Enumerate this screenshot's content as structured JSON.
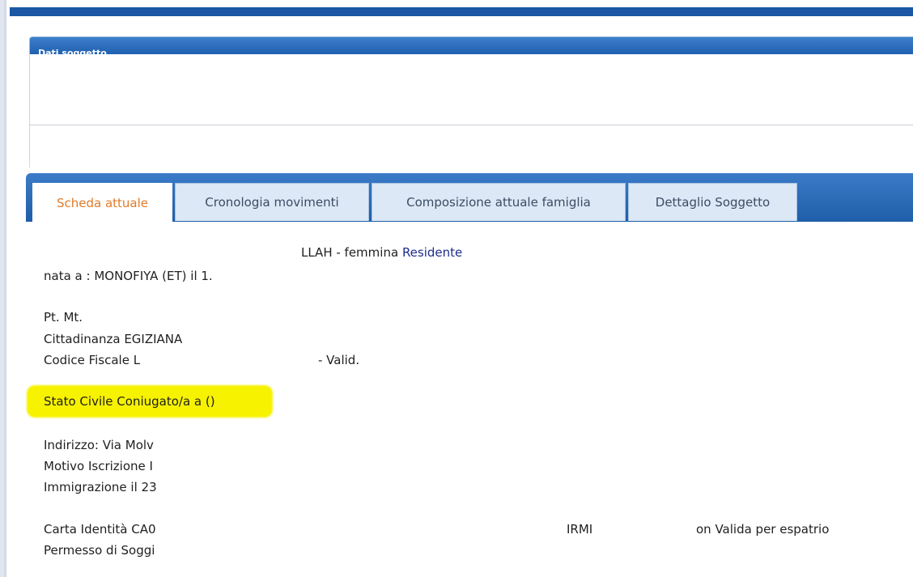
{
  "panel": {
    "title": "Dati soggetto"
  },
  "tabs": [
    {
      "label": "Scheda attuale",
      "active": true
    },
    {
      "label": "Cronologia movimenti",
      "active": false
    },
    {
      "label": "Composizione attuale famiglia",
      "active": false
    },
    {
      "label": "Dettaglio Soggetto",
      "active": false
    }
  ],
  "scheda": {
    "nome_suffix": "LLAH - femmina",
    "residenza": "Residente",
    "nascita": "nata a : MONOFIYA (ET) il 1.",
    "paternita": "Pt. Mt.",
    "cittadinanza": "Cittadinanza EGIZIANA",
    "codice_fiscale_label": "Codice Fiscale L",
    "codice_fiscale_status": "- Valid.",
    "stato_civile_label": "Stato Civile",
    "stato_civile_value": "Coniugato/a a ()",
    "indirizzo": "Indirizzo: Via Molv",
    "motivo_iscrizione": "Motivo Iscrizione I",
    "immigrazione": "Immigrazione il 23",
    "carta_identita": "Carta Identità CA0",
    "carta_fragment": "IRMI",
    "carta_status": "on Valida per espatrio",
    "permesso": "Permesso di Soggi"
  },
  "colors": {
    "header_blue": "#1b57a4",
    "tab_active_text": "#e07b2a",
    "highlight": "#f6f200",
    "residente_text": "#1e2e8c"
  }
}
